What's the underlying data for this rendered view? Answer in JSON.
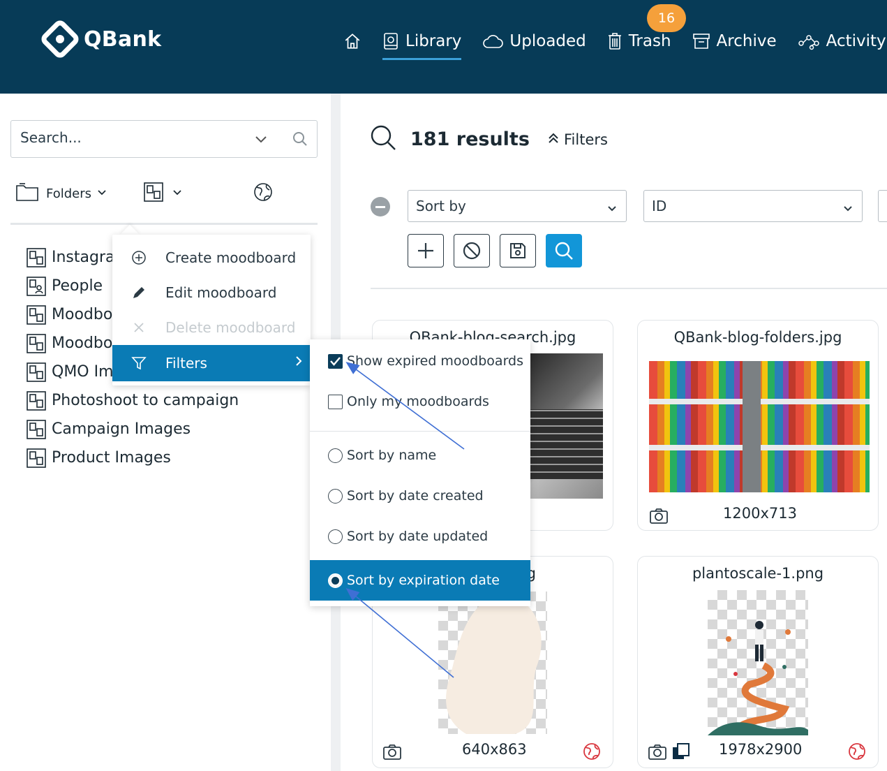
{
  "app": {
    "name": "QBank"
  },
  "nav": {
    "items": [
      {
        "label": "",
        "icon": "home-icon"
      },
      {
        "label": "Library",
        "icon": "library-icon",
        "active": true
      },
      {
        "label": "Uploaded",
        "icon": "cloud-icon"
      },
      {
        "label": "Trash",
        "icon": "trash-icon"
      },
      {
        "label": "Archive",
        "icon": "archive-icon"
      },
      {
        "label": "Activity",
        "icon": "activity-icon"
      }
    ],
    "trash_badge": "16"
  },
  "sidebar": {
    "search_placeholder": "Search...",
    "folders_label": "Folders",
    "tree": [
      "Instagram",
      "People",
      "Moodboard",
      "Moodboard",
      "QMO Images",
      "Photoshoot to campaign",
      "Campaign Images",
      "Product Images"
    ]
  },
  "context_menu": {
    "items": [
      {
        "label": "Create moodboard",
        "icon": "plus-circle-icon"
      },
      {
        "label": "Edit moodboard",
        "icon": "pencil-icon"
      },
      {
        "label": "Delete moodboard",
        "icon": "close-icon",
        "disabled": true
      },
      {
        "label": "Filters",
        "icon": "filter-icon",
        "highlighted": true
      }
    ]
  },
  "filters_submenu": {
    "checkboxes": [
      {
        "label": "Show expired moodboards",
        "checked": true
      },
      {
        "label": "Only my moodboards",
        "checked": false
      }
    ],
    "sort_options": [
      {
        "label": "Sort by name",
        "selected": false
      },
      {
        "label": "Sort by date created",
        "selected": false
      },
      {
        "label": "Sort by date updated",
        "selected": false
      },
      {
        "label": "Sort by expiration date",
        "selected": true
      }
    ]
  },
  "main": {
    "results_count": "181 results",
    "filters_toggle": "Filters",
    "sort_select": "Sort by",
    "field_select": "ID"
  },
  "cards": [
    {
      "title": "QBank-blog-search.jpg",
      "dims": ""
    },
    {
      "title": "QBank-blog-folders.jpg",
      "dims": "1200x713"
    },
    {
      "title": "g",
      "dims": "640x863"
    },
    {
      "title": "plantoscale-1.png",
      "dims": "1978x2900"
    }
  ],
  "colors": {
    "header_bg": "#073b57",
    "accent": "#0a7bb5",
    "badge": "#f5a03b",
    "primary_button": "#1296d8",
    "annotation_arrow": "#3f6fd4"
  }
}
